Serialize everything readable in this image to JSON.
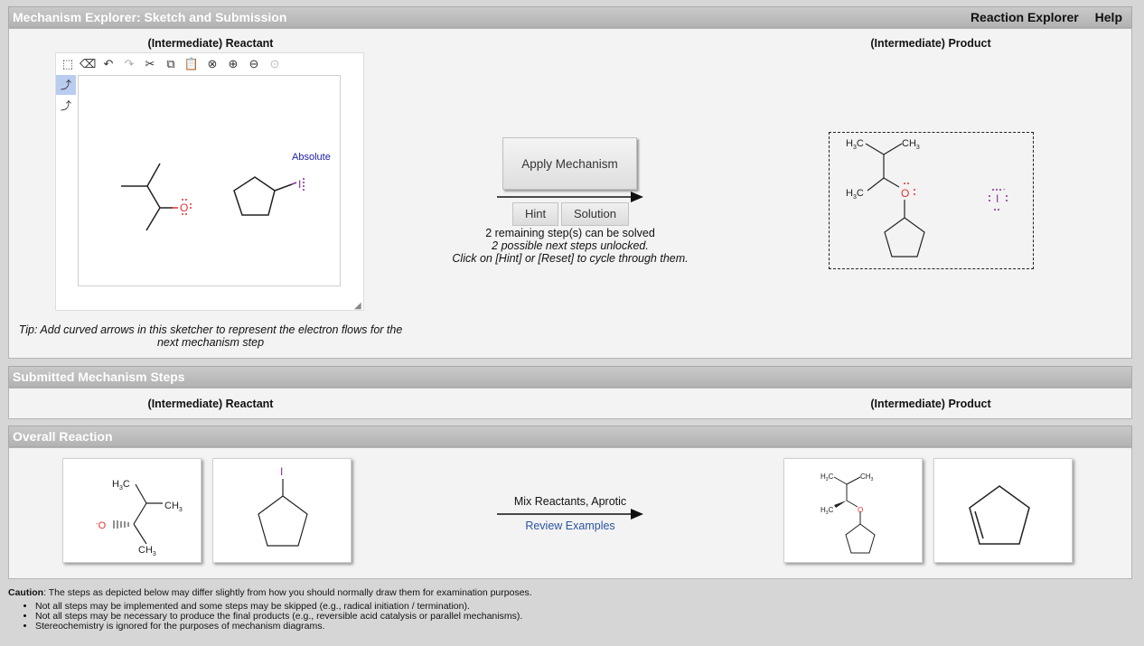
{
  "header": {
    "title": "Mechanism Explorer: Sketch and Submission",
    "links": [
      "Reaction Explorer",
      "Help"
    ]
  },
  "sketch_section": {
    "reactant_title": "(Intermediate) Reactant",
    "product_title": "(Intermediate) Product",
    "canvas_label": "Absolute",
    "tip": "Tip: Add curved arrows in this sketcher to represent the electron flows for the next mechanism step",
    "apply_button": "Apply Mechanism",
    "hint_button": "Hint",
    "solution_button": "Solution",
    "status_line1": "2 remaining step(s) can be solved",
    "status_line2": "2 possible next steps unlocked.",
    "status_line3": "Click on [Hint] or [Reset] to cycle through them."
  },
  "submitted_section": {
    "title": "Submitted Mechanism Steps",
    "reactant_title": "(Intermediate) Reactant",
    "product_title": "(Intermediate) Product"
  },
  "overall_section": {
    "title": "Overall Reaction",
    "conditions": "Mix Reactants, Aprotic",
    "review_link": "Review Examples"
  },
  "caution": {
    "label": "Caution",
    "text": ": The steps as depicted below may differ slightly from how you should normally draw them for examination purposes.",
    "items": [
      "Not all steps may be implemented and some steps may be skipped (e.g., radical initiation / termination).",
      "Not all steps may be necessary to produce the final products (e.g., reversible acid catalysis or parallel mechanisms).",
      "Stereochemistry is ignored for the purposes of mechanism diagrams."
    ]
  },
  "colors": {
    "oxygen": "#e53030",
    "iodine": "#8b2a9a",
    "header_bar": "#b8b8b8",
    "link": "#2a55a0"
  },
  "molecules": {
    "oxygen": "O",
    "iodine": "I",
    "h3c": "H",
    "ch3": "CH",
    "sub3": "3",
    "c": "C",
    "charge": "-"
  }
}
